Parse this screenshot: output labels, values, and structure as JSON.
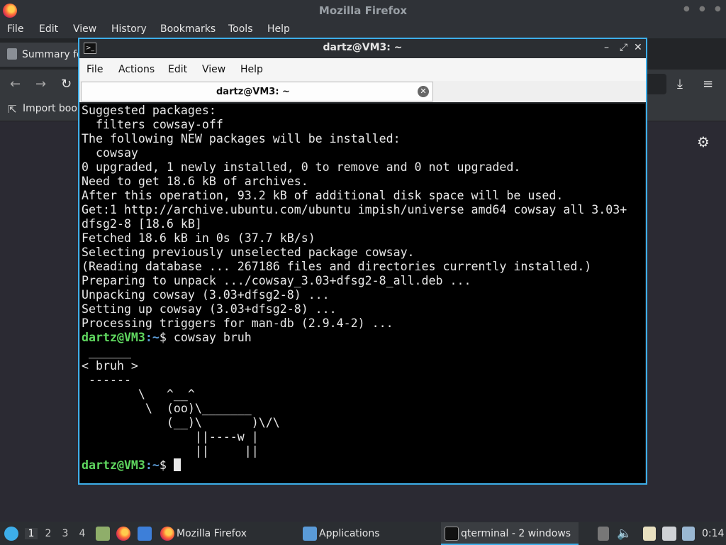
{
  "firefox": {
    "title": "Mozilla Firefox",
    "menu": [
      "File",
      "Edit",
      "View",
      "History",
      "Bookmarks",
      "Tools",
      "Help"
    ],
    "tab_label": "Summary fo",
    "bookmark_label": "Import book"
  },
  "terminal": {
    "title": "dartz@VM3: ~",
    "menu": [
      "File",
      "Actions",
      "Edit",
      "View",
      "Help"
    ],
    "tab_label": "dartz@VM3: ~",
    "prompt_user": "dartz@VM3",
    "prompt_path": ":~",
    "prompt_symbol": "$ ",
    "command": "cowsay bruh",
    "output_lines": [
      "Suggested packages:",
      "  filters cowsay-off",
      "The following NEW packages will be installed:",
      "  cowsay",
      "0 upgraded, 1 newly installed, 0 to remove and 0 not upgraded.",
      "Need to get 18.6 kB of archives.",
      "After this operation, 93.2 kB of additional disk space will be used.",
      "Get:1 http://archive.ubuntu.com/ubuntu impish/universe amd64 cowsay all 3.03+",
      "dfsg2-8 [18.6 kB]",
      "Fetched 18.6 kB in 0s (37.7 kB/s)",
      "Selecting previously unselected package cowsay.",
      "(Reading database ... 267186 files and directories currently installed.)",
      "Preparing to unpack .../cowsay_3.03+dfsg2-8_all.deb ...",
      "Unpacking cowsay (3.03+dfsg2-8) ...",
      "Setting up cowsay (3.03+dfsg2-8) ...",
      "Processing triggers for man-db (2.9.4-2) ..."
    ],
    "cow_lines": [
      " ______",
      "< bruh >",
      " ------",
      "        \\   ^__^",
      "         \\  (oo)\\_______",
      "            (__)\\       )\\/\\",
      "                ||----w |",
      "                ||     ||"
    ]
  },
  "taskbar": {
    "workspaces": [
      "1",
      "2",
      "3",
      "4"
    ],
    "firefox_label": "Mozilla Firefox",
    "apps_label": "Applications",
    "term_label": "qterminal - 2 windows",
    "clock": "0:14"
  }
}
